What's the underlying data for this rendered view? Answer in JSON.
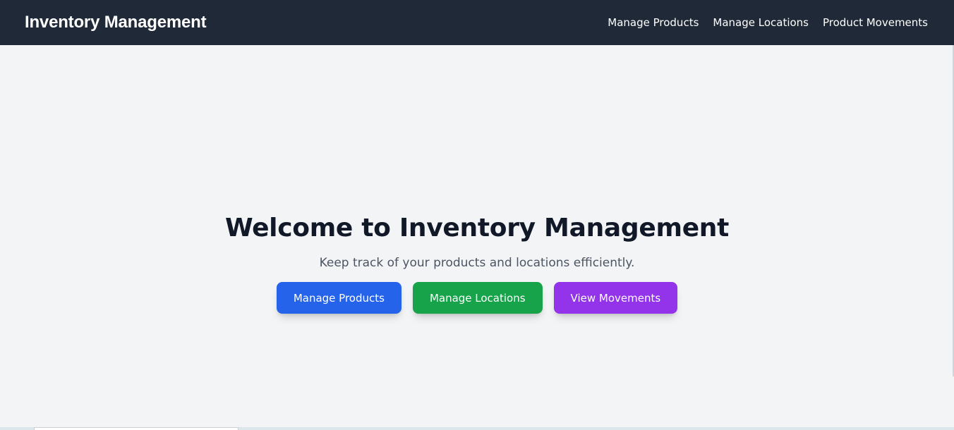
{
  "navbar": {
    "brand": "Inventory Management",
    "links": [
      {
        "label": "Manage Products"
      },
      {
        "label": "Manage Locations"
      },
      {
        "label": "Product Movements"
      }
    ],
    "background_color": "#1f2937"
  },
  "hero": {
    "title": "Welcome to Inventory Management",
    "subtitle": "Keep track of your products and locations efficiently.",
    "buttons": [
      {
        "label": "Manage Products",
        "color": "#2563eb"
      },
      {
        "label": "Manage Locations",
        "color": "#16a34a"
      },
      {
        "label": "View Movements",
        "color": "#9333ea"
      }
    ]
  },
  "page": {
    "background_color": "#f3f4f6"
  }
}
